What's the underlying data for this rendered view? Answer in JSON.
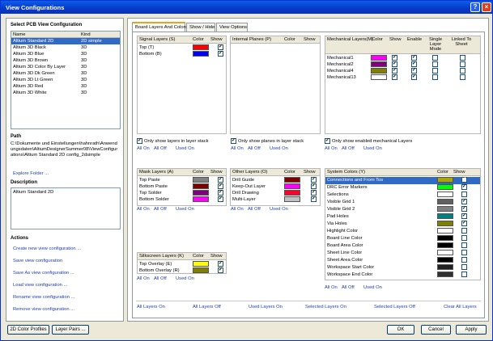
{
  "window": {
    "title": "View Configurations"
  },
  "left": {
    "select_header": "Select PCB View Configuration",
    "list_headers": [
      "Name",
      "Kind"
    ],
    "configs": [
      {
        "name": "Altium Standard 2D",
        "kind": "2D simple",
        "selected": true
      },
      {
        "name": "Altium 3D Black",
        "kind": "3D"
      },
      {
        "name": "Altium 3D Blue",
        "kind": "3D"
      },
      {
        "name": "Altium 3D Brown",
        "kind": "3D"
      },
      {
        "name": "Altium 3D Color By Layer",
        "kind": "3D"
      },
      {
        "name": "Altium 3D Dk Green",
        "kind": "3D"
      },
      {
        "name": "Altium 3D Lt Green",
        "kind": "3D"
      },
      {
        "name": "Altium 3D Red",
        "kind": "3D"
      },
      {
        "name": "Altium 3D White",
        "kind": "3D"
      }
    ],
    "path_header": "Path",
    "path_text": "C:\\Dokumente und Einstellungen\\hahnrath\\Anwendungsdaten\\AltiumDesignerSummer08\\ViewConfigurations\\Altium Standard 2D config_2dsimple",
    "explore_folder": "Explore Folder ...",
    "description_header": "Description",
    "description_text": "Altium Standard 2D",
    "actions_header": "Actions",
    "actions": [
      "Create new view configuration ...",
      "Save view configuration",
      "Save As view configuration ...",
      "Load view configuration ...",
      "Rename view configuration ...",
      "Remove view configuration ..."
    ]
  },
  "tabs": [
    "Board Layers And Colors",
    "Show / Hide",
    "View Options"
  ],
  "col": {
    "color": "Color",
    "show": "Show",
    "enable": "Enable",
    "single": "Single Layer Mode",
    "linked": "Linked To Sheet"
  },
  "links": {
    "all_on": "All On",
    "all_off": "All Off",
    "used_on": "Used On"
  },
  "signal": {
    "title": "Signal Layers (S)",
    "rows": [
      {
        "name": "Top (T)",
        "color": "#ff0000",
        "show": true
      },
      {
        "name": "Bottom (B)",
        "color": "#0000ff",
        "show": true
      }
    ],
    "only_show": "Only show layers in layer stack"
  },
  "internal": {
    "title": "Internal Planes (P)",
    "only_show": "Only show planes in layer stack"
  },
  "mechanical": {
    "title": "Mechanical Layers(M)",
    "rows": [
      {
        "name": "Mechanical1",
        "color": "#ff00ff",
        "show": true,
        "enable": true
      },
      {
        "name": "Mechanical2",
        "color": "#800080",
        "show": true,
        "enable": true
      },
      {
        "name": "Mechanical4",
        "color": "#808000",
        "show": true,
        "enable": true
      },
      {
        "name": "Mechanical13",
        "color": "#ffffff",
        "show": true,
        "enable": true
      }
    ],
    "only_show": "Only show enabled mechanical Layers"
  },
  "mask": {
    "title": "Mask Layers (A)",
    "rows": [
      {
        "name": "Top Paste",
        "color": "#808080",
        "show": true
      },
      {
        "name": "Bottom Paste",
        "color": "#800000",
        "show": true
      },
      {
        "name": "Top Solder",
        "color": "#800080",
        "show": true
      },
      {
        "name": "Bottom Solder",
        "color": "#ff00ff",
        "show": true
      }
    ]
  },
  "other": {
    "title": "Other Layers (O)",
    "rows": [
      {
        "name": "Drill Guide",
        "color": "#800000",
        "show": true
      },
      {
        "name": "Keep-Out Layer",
        "color": "#ff00ff",
        "show": true
      },
      {
        "name": "Drill Drawing",
        "color": "#ff002a",
        "show": true
      },
      {
        "name": "Multi-Layer",
        "color": "#c0c0c0",
        "show": true
      }
    ]
  },
  "system": {
    "title": "System Colors (Y)",
    "rows": [
      {
        "name": "Connections and From Tos",
        "color": "#a8a800",
        "show": true,
        "selected": true
      },
      {
        "name": "DRC Error Markers",
        "color": "#00ff00",
        "show": true
      },
      {
        "name": "Selections",
        "color": "#ffffff",
        "show": false
      },
      {
        "name": "Visible Grid 1",
        "color": "#606060",
        "show": true
      },
      {
        "name": "Visible Grid 2",
        "color": "#808080",
        "show": true
      },
      {
        "name": "Pad Holes",
        "color": "#008080",
        "show": true
      },
      {
        "name": "Via Holes",
        "color": "#808000",
        "show": true
      },
      {
        "name": "Highlight Color",
        "color": "#ffffff",
        "show": false
      },
      {
        "name": "Board Line Color",
        "color": "#000000",
        "show": false
      },
      {
        "name": "Board Area Color",
        "color": "#000000",
        "show": false
      },
      {
        "name": "Sheet Line Color",
        "color": "#ffffff",
        "show": false
      },
      {
        "name": "Sheet Area Color",
        "color": "#000000",
        "show": false
      },
      {
        "name": "Workspace Start Color",
        "color": "#202020",
        "show": false
      },
      {
        "name": "Workspace End Color",
        "color": "#303030",
        "show": false
      }
    ]
  },
  "silkscreen": {
    "title": "Silkscreen Layers (K)",
    "rows": [
      {
        "name": "Top Overlay (E)",
        "color": "#ffff00",
        "show": true
      },
      {
        "name": "Bottom Overlay (R)",
        "color": "#808000",
        "show": true
      }
    ]
  },
  "bottom_links": [
    "All Layers On",
    "All Layers Off",
    "Used Layers On",
    "Selected Layers On",
    "Selected Layers Off",
    "Clear All Layers"
  ],
  "buttons": {
    "color_profiles": "2D Color Profiles",
    "layer_pairs": "Layer Pairs ...",
    "ok": "OK",
    "cancel": "Cancel",
    "apply": "Apply"
  }
}
